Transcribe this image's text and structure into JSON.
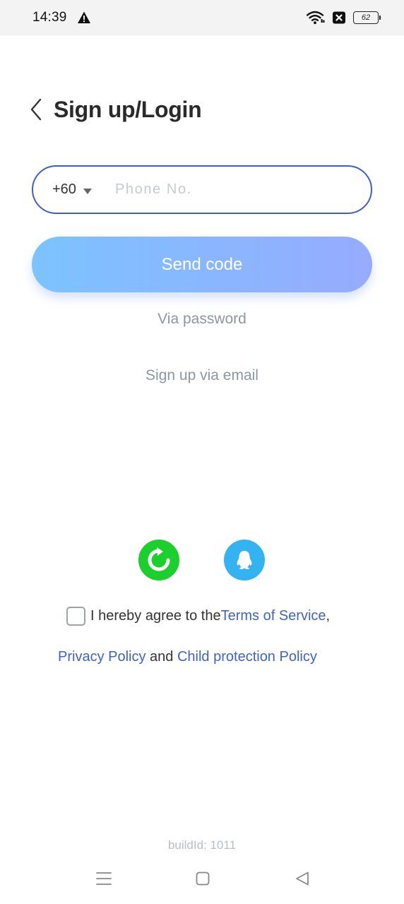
{
  "status_bar": {
    "time": "14:39",
    "battery_level": "62",
    "icons": [
      "warning-icon",
      "wifi-icon",
      "sim-off-icon",
      "battery-icon"
    ]
  },
  "header": {
    "title": "Sign up/Login",
    "back_icon": "chevron-left-icon"
  },
  "phone_form": {
    "country_code": "+60",
    "phone_placeholder": "Phone No.",
    "phone_value": ""
  },
  "actions": {
    "send_code_label": "Send code",
    "via_password_label": "Via password",
    "sign_up_email_label": "Sign up via email"
  },
  "social_login": {
    "buttons": [
      {
        "name": "wechat-style-icon",
        "color": "#1bcf2c"
      },
      {
        "name": "qq-icon",
        "color": "#33b3f1"
      }
    ]
  },
  "agreement": {
    "prefix": "I hereby agree to the",
    "terms_link": "Terms of Service",
    "comma": " ,",
    "privacy_link": "Privacy Policy",
    "and_text": " and ",
    "child_link": "Child protection Policy",
    "checked": false
  },
  "footer": {
    "build_id": "buildId: 1011"
  },
  "colors": {
    "accent_blue": "#3e63c6",
    "gradient_start": "#7cc3ff",
    "gradient_end": "#96abff",
    "muted_text": "#8e96a2"
  }
}
